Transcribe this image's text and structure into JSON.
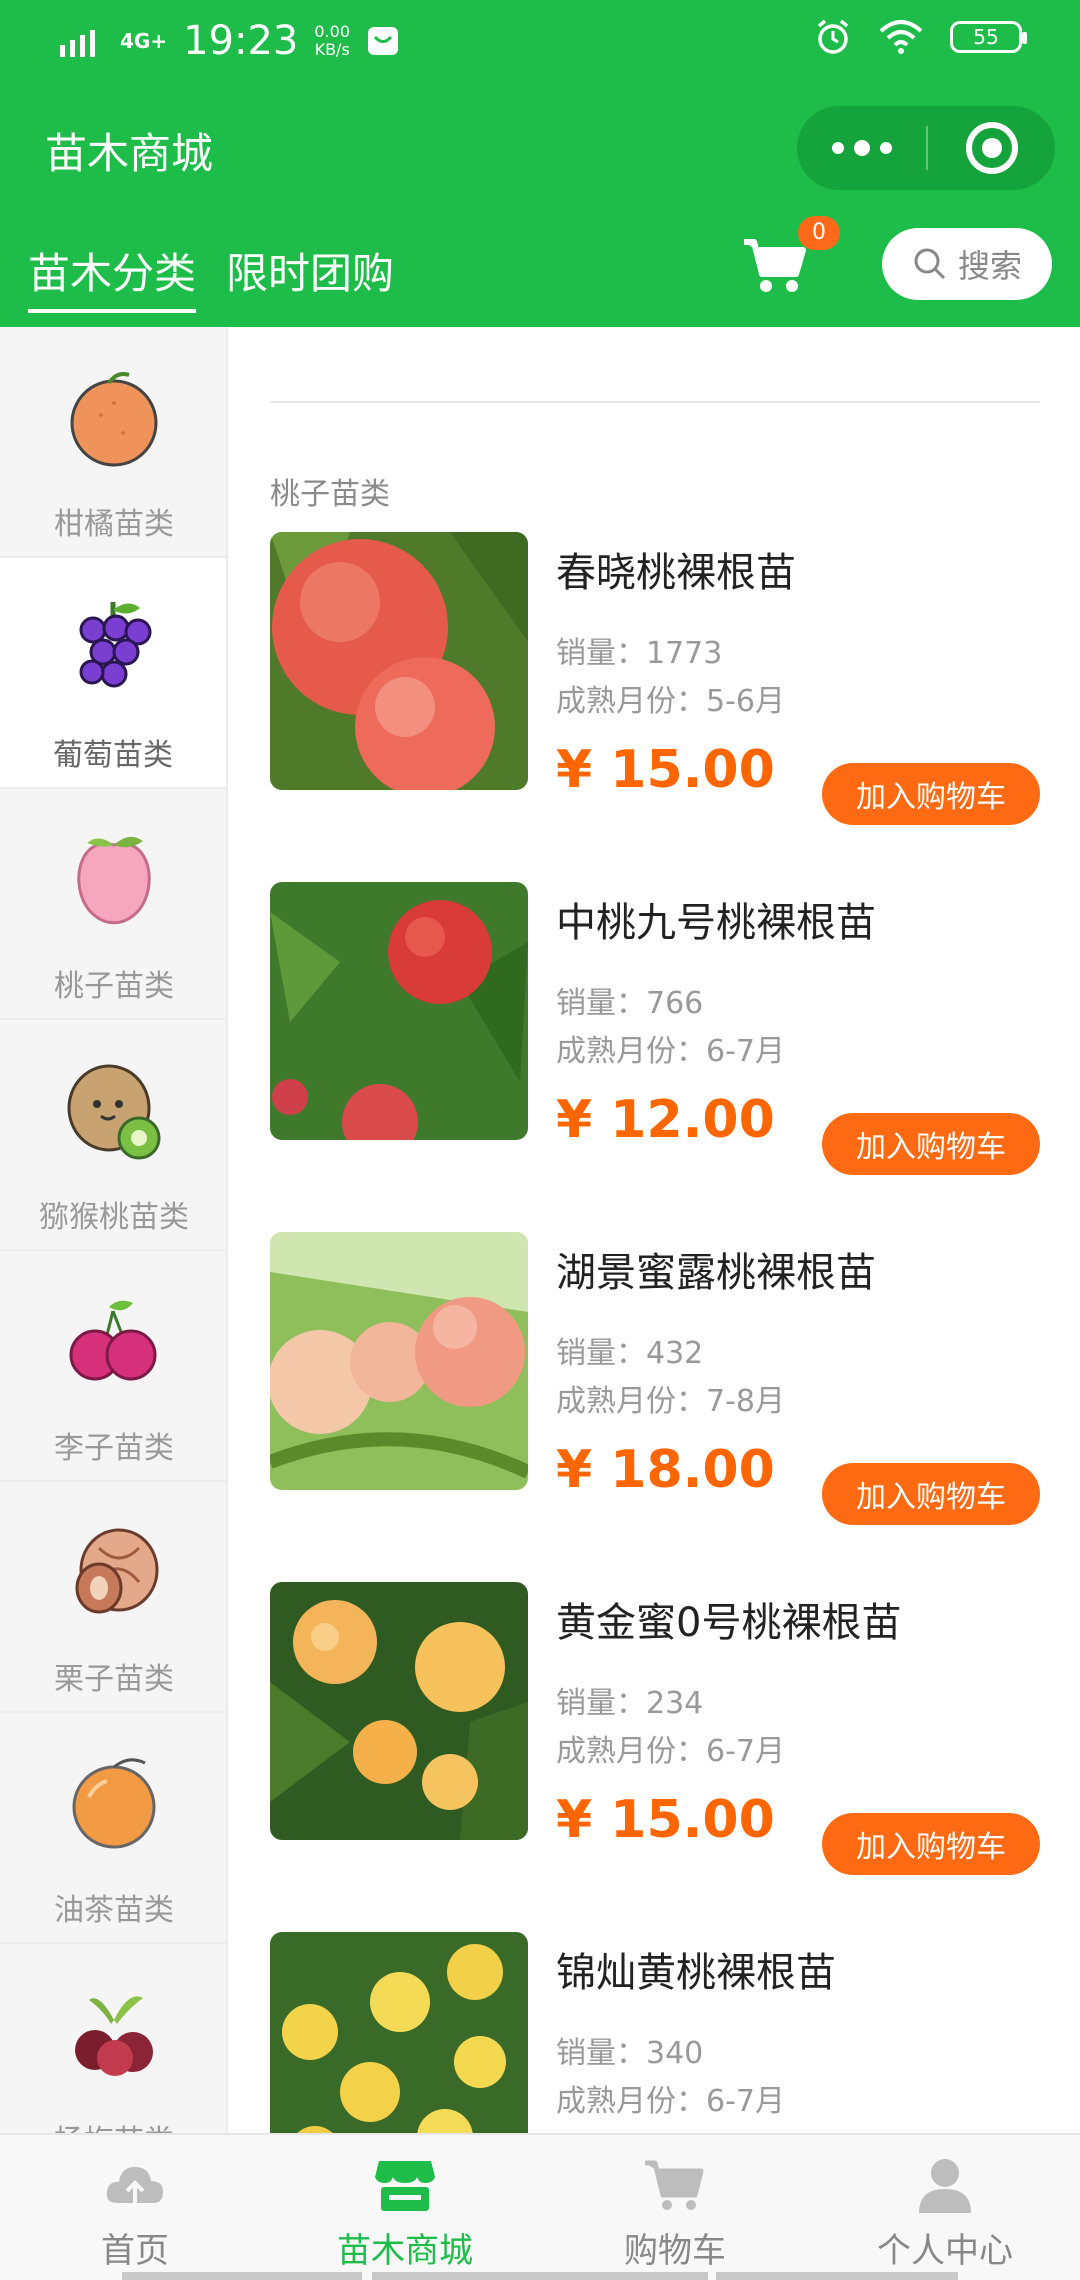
{
  "statusbar": {
    "network": "4G+",
    "time": "19:23",
    "speed_value": "0.00",
    "speed_unit": "KB/s",
    "battery": "55"
  },
  "header": {
    "title": "苗木商城",
    "tabs": [
      {
        "label": "苗木分类",
        "active": true
      },
      {
        "label": "限时团购",
        "active": false
      }
    ],
    "cart_count": "0",
    "search_label": "搜索"
  },
  "sidebar": {
    "categories": [
      {
        "label": "柑橘苗类",
        "icon": "orange-icon",
        "active": false
      },
      {
        "label": "葡萄苗类",
        "icon": "grape-icon",
        "active": true
      },
      {
        "label": "桃子苗类",
        "icon": "peach-icon",
        "active": false
      },
      {
        "label": "猕猴桃苗类",
        "icon": "kiwi-icon",
        "active": false
      },
      {
        "label": "李子苗类",
        "icon": "plum-icon",
        "active": false
      },
      {
        "label": "栗子苗类",
        "icon": "chestnut-icon",
        "active": false
      },
      {
        "label": "油茶苗类",
        "icon": "camellia-fruit-icon",
        "active": false
      },
      {
        "label": "杨梅苗类",
        "icon": "bayberry-icon",
        "active": false
      }
    ]
  },
  "content": {
    "section_title": "桃子苗类",
    "add_to_cart_label": "加入购物车",
    "products": [
      {
        "name": "春晓桃裸根苗",
        "sales": "销量：1773",
        "month": "成熟月份：5-6月",
        "price": "¥ 15.00",
        "image": "red-peaches-photo"
      },
      {
        "name": "中桃九号桃裸根苗",
        "sales": "销量：766",
        "month": "成熟月份：6-7月",
        "price": "¥ 12.00",
        "image": "peach-tree-photo"
      },
      {
        "name": "湖景蜜露桃裸根苗",
        "sales": "销量：432",
        "month": "成熟月份：7-8月",
        "price": "¥ 18.00",
        "image": "pale-peaches-photo"
      },
      {
        "name": "黄金蜜0号桃裸根苗",
        "sales": "销量：234",
        "month": "成熟月份：6-7月",
        "price": "¥ 15.00",
        "image": "yellow-peaches-photo"
      },
      {
        "name": "锦灿黄桃裸根苗",
        "sales": "销量：340",
        "month": "成熟月份：6-7月",
        "price": "",
        "image": "golden-peaches-photo"
      }
    ]
  },
  "bottom_nav": {
    "items": [
      {
        "label": "首页",
        "icon": "home-cloud-icon",
        "active": false
      },
      {
        "label": "苗木商城",
        "icon": "store-icon",
        "active": true
      },
      {
        "label": "购物车",
        "icon": "cart-icon",
        "active": false
      },
      {
        "label": "个人中心",
        "icon": "profile-icon",
        "active": false
      }
    ]
  },
  "colors": {
    "brand_green": "#1ebd4a",
    "accent_orange": "#ff6600",
    "button_orange": "#ff6a13"
  }
}
